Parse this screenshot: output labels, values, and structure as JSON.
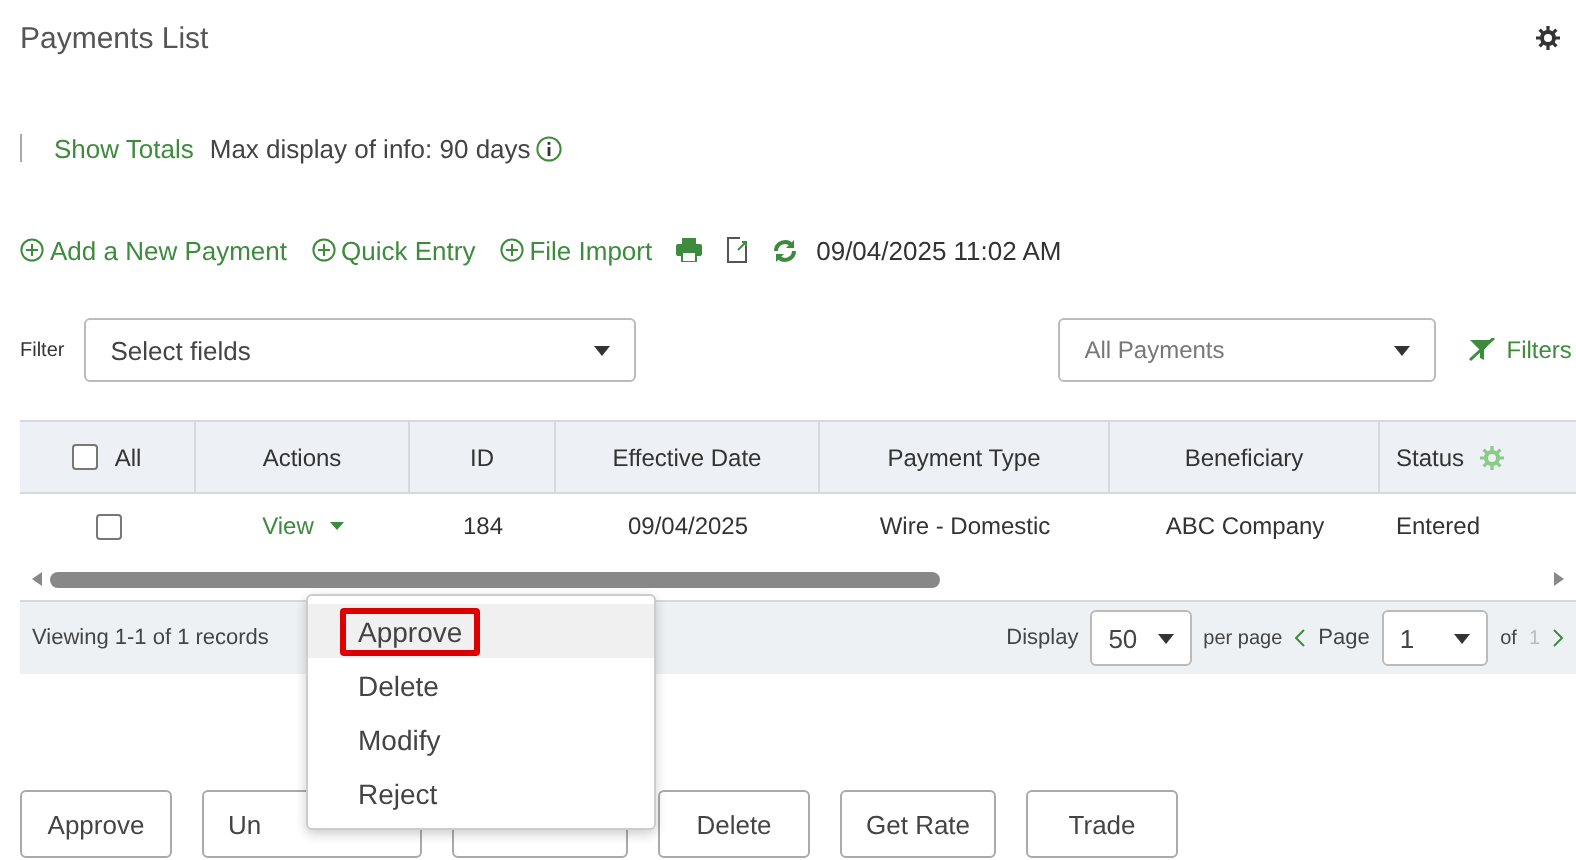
{
  "title": "Payments List",
  "show_totals": "Show Totals",
  "info": "Max display of info: 90 days",
  "toolbar": [
    {
      "kind": "add",
      "label": "Add a New Payment"
    },
    {
      "kind": "add",
      "label": "Quick Entry"
    },
    {
      "kind": "add",
      "label": "File Import"
    },
    {
      "kind": "print"
    },
    {
      "kind": "export"
    },
    {
      "kind": "refresh",
      "label": "09/04/2025 11:02 AM"
    }
  ],
  "filter": {
    "label": "Filter",
    "value": "Select fields"
  },
  "payment_filter": {
    "value": "All Payments"
  },
  "filters_link": "Filters",
  "table": {
    "select_all_checked": false,
    "columns": [
      "All",
      "Actions",
      "ID",
      "Effective Date",
      "Payment Type",
      "Beneficiary",
      "Status"
    ],
    "rows": [
      {
        "cells": [
          {
            "kind": "checkbox",
            "checked": false
          },
          {
            "kind": "link",
            "label": "View"
          },
          "184",
          "09/04/2025",
          "Wire - Domestic",
          "ABC Company",
          "Entered"
        ]
      }
    ]
  },
  "footer": {
    "viewing": "Viewing 1-1 of 1 records",
    "display_label": "Display",
    "page_size": "50",
    "per_page": "per page",
    "page_label": "Page",
    "page": "1",
    "of_label": "of",
    "total_pages": "1"
  },
  "action_menu": [
    {
      "label": "Approve",
      "selected": true
    },
    {
      "label": "Delete",
      "selected": false
    },
    {
      "label": "Modify",
      "selected": false
    },
    {
      "label": "Reject",
      "selected": false
    }
  ],
  "buttons": [
    {
      "kind": "button",
      "label": "Approve"
    },
    {
      "kind": "button",
      "label": "Un"
    },
    {
      "kind": "covered"
    },
    {
      "kind": "button",
      "label": "Delete"
    },
    {
      "kind": "button",
      "label": "Get Rate"
    },
    {
      "kind": "button",
      "label": "Trade"
    }
  ]
}
